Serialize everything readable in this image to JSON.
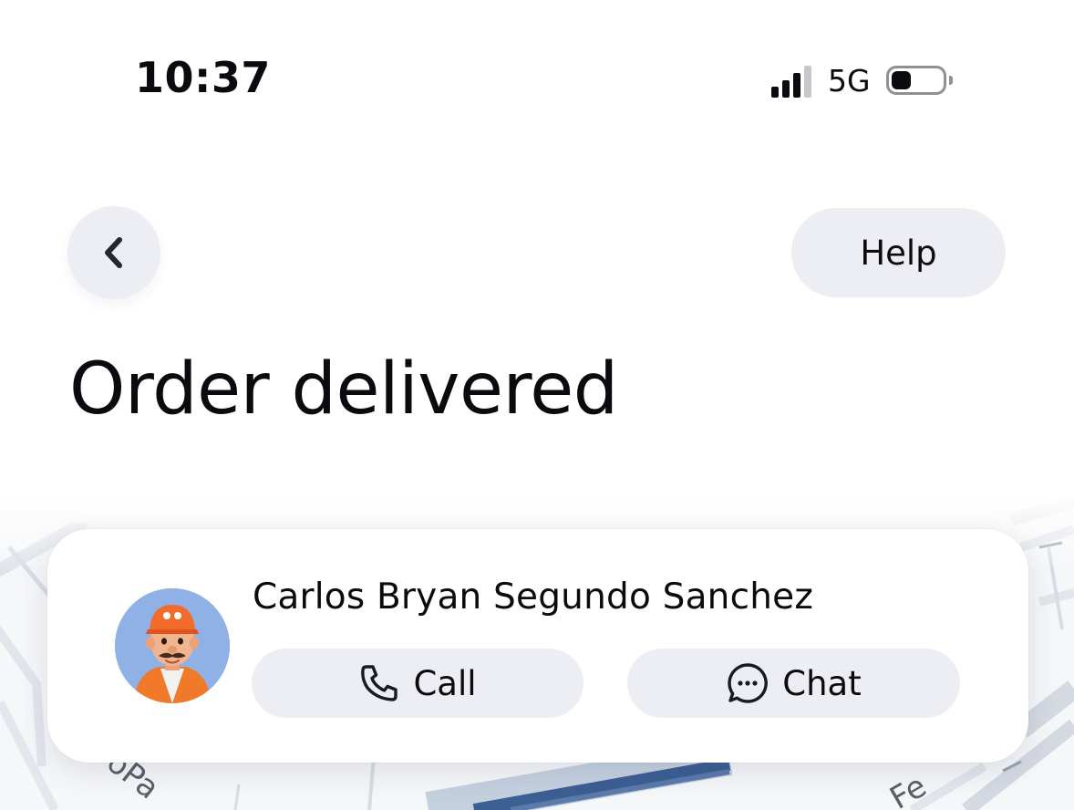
{
  "status_bar": {
    "time": "10:37",
    "network": "5G",
    "icons": [
      "cellular-signal-icon",
      "battery-icon"
    ]
  },
  "header": {
    "back_icon": "chevron-left-icon",
    "help_label": "Help"
  },
  "page": {
    "title": "Order delivered"
  },
  "courier": {
    "name": "Carlos Bryan Segundo Sanchez",
    "avatar": "courier-avatar-cartoon",
    "call_label": "Call",
    "call_icon": "phone-icon",
    "chat_label": "Chat",
    "chat_icon": "chat-bubble-icon"
  },
  "map": {
    "labels": [
      "oPa",
      "Fe"
    ]
  },
  "colors": {
    "text": "#0b0b0f",
    "button_bg": "#eceef3",
    "card_bg": "#ffffff",
    "avatar_bg": "#8fb1e6",
    "map_road": "#dfe3ea",
    "map_route": "#3c5f94"
  }
}
